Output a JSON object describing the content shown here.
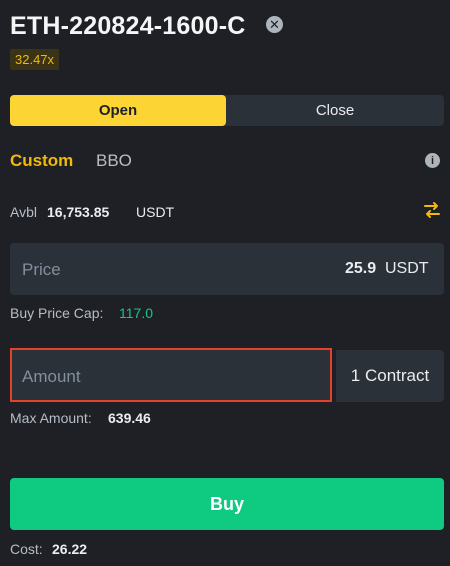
{
  "header": {
    "symbol": "ETH-220824-1600-C",
    "close_icon": "close-circle-icon",
    "leverage": "32.47x"
  },
  "side_toggle": {
    "open_label": "Open",
    "close_label": "Close",
    "selected": "Open"
  },
  "order_type_tabs": {
    "custom_label": "Custom",
    "bbo_label": "BBO",
    "selected": "Custom",
    "info_icon": "info-icon"
  },
  "balance": {
    "label": "Avbl",
    "value": "16,753.85",
    "unit": "USDT",
    "swap_icon": "swap-arrows-icon"
  },
  "price": {
    "label": "Price",
    "value": "25.9",
    "unit": "USDT"
  },
  "price_cap": {
    "label": "Buy Price Cap:",
    "value": "117.0"
  },
  "amount": {
    "placeholder": "Amount",
    "unit_label": "1 Contract"
  },
  "max_amount": {
    "label": "Max Amount:",
    "value": "639.46"
  },
  "buy_button": {
    "label": "Buy"
  },
  "cost": {
    "label": "Cost:",
    "value": "26.22"
  },
  "colors": {
    "background": "#1e2026",
    "accent_yellow": "#fcd535",
    "buy_green": "#0ecb81",
    "highlight_red": "#e4412b"
  }
}
